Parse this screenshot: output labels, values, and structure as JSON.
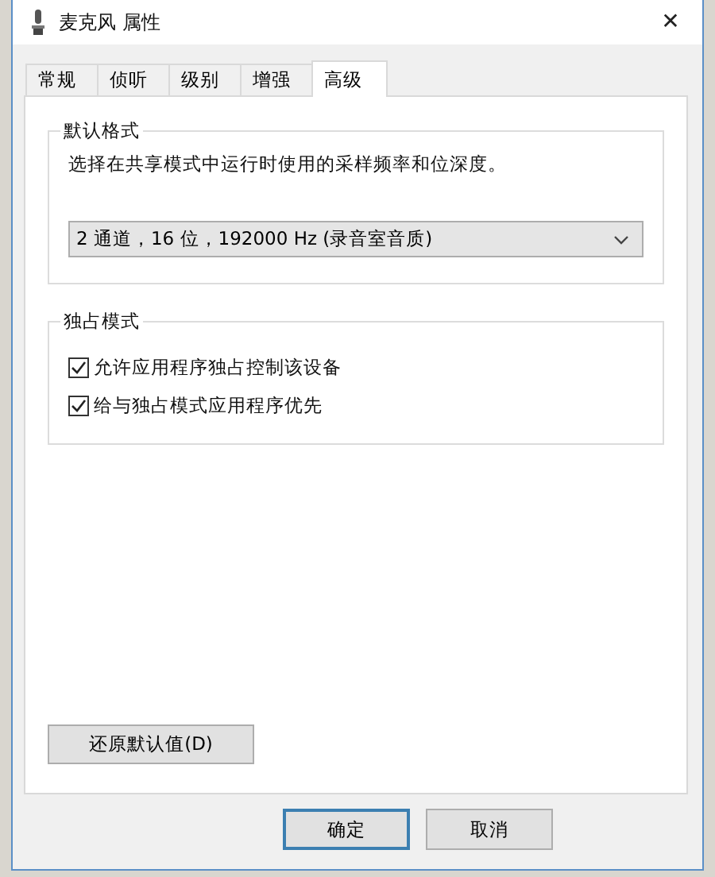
{
  "window": {
    "title": "麦克风 属性",
    "close": "✕"
  },
  "tabs": [
    {
      "label": "常规",
      "selected": false
    },
    {
      "label": "侦听",
      "selected": false
    },
    {
      "label": "级别",
      "selected": false
    },
    {
      "label": "增强",
      "selected": false
    },
    {
      "label": "高级",
      "selected": true
    }
  ],
  "default_format": {
    "title": "默认格式",
    "description": "选择在共享模式中运行时使用的采样频率和位深度。",
    "dropdown": {
      "value": "2 通道，16 位，192000 Hz (录音室音质)"
    }
  },
  "exclusive_mode": {
    "title": "独占模式",
    "options": [
      {
        "label": "允许应用程序独占控制该设备",
        "checked": true
      },
      {
        "label": "给与独占模式应用程序优先",
        "checked": true
      }
    ]
  },
  "restore_button": "还原默认值(D)",
  "buttons": [
    {
      "label": "确定",
      "default": true
    },
    {
      "label": "取消",
      "default": false
    }
  ]
}
